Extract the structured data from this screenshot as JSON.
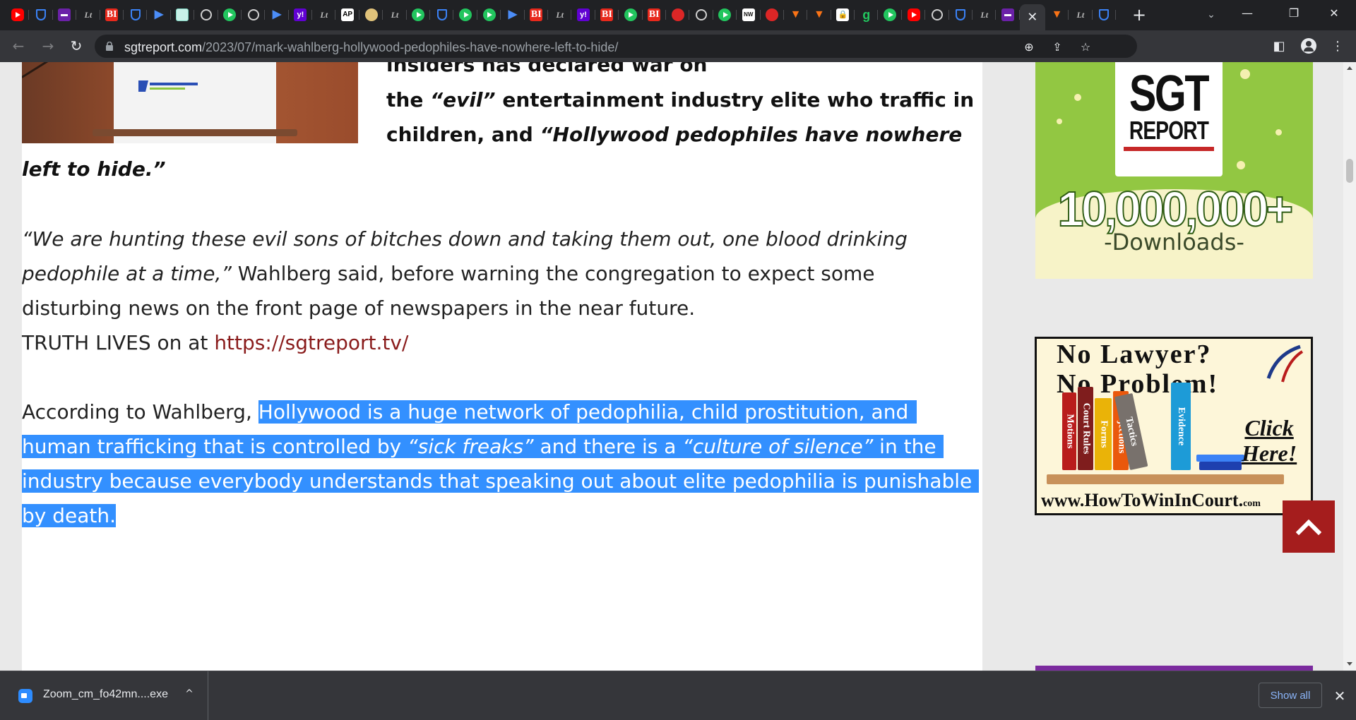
{
  "tabs": [
    {
      "icon": "youtube-icon",
      "glyph": ""
    },
    {
      "icon": "shield-icon",
      "glyph": ""
    },
    {
      "icon": "purple-mail-icon",
      "glyph": ""
    },
    {
      "icon": "lite-icon",
      "glyph": "Lt"
    },
    {
      "icon": "bi-icon",
      "glyph": "BI"
    },
    {
      "icon": "shield-icon",
      "glyph": ""
    },
    {
      "icon": "feedly-icon",
      "glyph": "▶"
    },
    {
      "icon": "grid-icon",
      "glyph": ""
    },
    {
      "icon": "globe-icon",
      "glyph": ""
    },
    {
      "icon": "play-icon",
      "glyph": ""
    },
    {
      "icon": "globe-icon",
      "glyph": ""
    },
    {
      "icon": "feedly-icon",
      "glyph": "▶"
    },
    {
      "icon": "yahoo-icon",
      "glyph": "y!"
    },
    {
      "icon": "lite-icon",
      "glyph": "Lt"
    },
    {
      "icon": "ap-icon",
      "glyph": "AP"
    },
    {
      "icon": "gold-icon",
      "glyph": ""
    },
    {
      "icon": "lite-icon",
      "glyph": "Lt"
    },
    {
      "icon": "play-icon",
      "glyph": ""
    },
    {
      "icon": "shield-icon",
      "glyph": ""
    },
    {
      "icon": "play-icon",
      "glyph": ""
    },
    {
      "icon": "play-icon",
      "glyph": ""
    },
    {
      "icon": "feedly-icon",
      "glyph": "▶"
    },
    {
      "icon": "bi-icon",
      "glyph": "BI"
    },
    {
      "icon": "lite-icon",
      "glyph": "Lt"
    },
    {
      "icon": "yahoo-icon",
      "glyph": "y!"
    },
    {
      "icon": "bi-icon",
      "glyph": "BI"
    },
    {
      "icon": "play-icon",
      "glyph": ""
    },
    {
      "icon": "bi-icon",
      "glyph": "BI"
    },
    {
      "icon": "pin-icon",
      "glyph": ""
    },
    {
      "icon": "globe-icon",
      "glyph": ""
    },
    {
      "icon": "play-icon",
      "glyph": ""
    },
    {
      "icon": "nw-icon",
      "glyph": "NW"
    },
    {
      "icon": "pin-icon",
      "glyph": ""
    },
    {
      "icon": "bookmark-icon",
      "glyph": "▼"
    },
    {
      "icon": "bookmark-icon",
      "glyph": "▼"
    },
    {
      "icon": "lock-icon",
      "glyph": "🔒"
    },
    {
      "icon": "green-g-icon",
      "glyph": "g"
    },
    {
      "icon": "play-icon",
      "glyph": ""
    },
    {
      "icon": "youtube-icon",
      "glyph": ""
    },
    {
      "icon": "globe-icon",
      "glyph": ""
    },
    {
      "icon": "shield-icon",
      "glyph": ""
    },
    {
      "icon": "lite-icon",
      "glyph": "Lt"
    },
    {
      "icon": "purple-mail-icon",
      "glyph": ""
    }
  ],
  "tabs_after_active": [
    {
      "icon": "bookmark-icon",
      "glyph": "▼"
    },
    {
      "icon": "lite-icon",
      "glyph": "Lt"
    },
    {
      "icon": "shield-icon",
      "glyph": ""
    }
  ],
  "active_tab": {
    "close_glyph": "✕"
  },
  "tabstrip": {
    "new_tab_glyph": "+",
    "search_glyph": "⌄",
    "minimize_glyph": "—",
    "restore_glyph": "❐",
    "close_glyph": "✕"
  },
  "toolbar": {
    "back_glyph": "←",
    "forward_glyph": "→",
    "reload_glyph": "↻",
    "url_host": "sgtreport.com",
    "url_path": "/2023/07/mark-wahlberg-hollywood-pedophiles-have-nowhere-left-to-hide/",
    "zoom_glyph": "⊕",
    "share_glyph": "⇪",
    "star_glyph": "☆",
    "sidepanel_glyph": "◧",
    "menu_glyph": "⋮"
  },
  "article": {
    "line_top_partial": "insiders has declared war on",
    "line1_pre": "the ",
    "line1_it": "“evil”",
    "line1_post": " entertainment industry elite who traffic in",
    "line2_pre": "children, and ",
    "line2_it": "“Hollywood pedophiles have nowhere",
    "line3_it": "left to hide.”",
    "quote_l1": "“We are hunting these evil sons of bitches down and taking them out, one blood drinking",
    "quote_l2_it": "pedophile at a time,”",
    "quote_l2_post": " Wahlberg said, before warning the congregation to expect some",
    "quote_l3": "disturbing news on the front page of newspapers in the near future.",
    "truth_pre": "TRUTH LIVES on at ",
    "truth_link": "https://sgtreport.tv/",
    "p2_l1_pre": "According to Wahlberg, ",
    "p2_l1_sel": "Hollywood is a huge network of pedophilia, child prostitution, and",
    "p2_l2_a": "human trafficking that is controlled by ",
    "p2_l2_it1": "“sick freaks”",
    "p2_l2_b": " and there is a ",
    "p2_l2_it2": "“culture of silence”",
    "p2_l2_c": " in the",
    "p2_l3": "industry because everybody understands that speaking out about elite pedophilia is punishable",
    "p2_l4": "by death."
  },
  "ads": {
    "sgt_word": "SGT",
    "sgt_report": "REPORT",
    "sgt_count": "10,000,000+",
    "sgt_downloads": "-Downloads-",
    "law_l1": "No Lawyer?",
    "law_l2": "No Problem!",
    "law_click_1": "Click",
    "law_click_2": "Here!",
    "law_url": "www.HowToWinInCourt.",
    "law_url_small": "com",
    "books": [
      "Motions",
      "Court Rules",
      "Forms",
      "Objections",
      "Tactics",
      "Evidence"
    ]
  },
  "downloads": {
    "file_name": "Zoom_cm_fo42mn....exe",
    "chevron_glyph": "^",
    "show_all": "Show all",
    "close_glyph": "✕"
  },
  "colors": {
    "selection": "#3390ff",
    "link": "#8a1c1c",
    "back_to_top": "#a51d1d",
    "ad_green": "#92c742",
    "tabstrip": "#202124",
    "toolbar": "#35363a"
  }
}
